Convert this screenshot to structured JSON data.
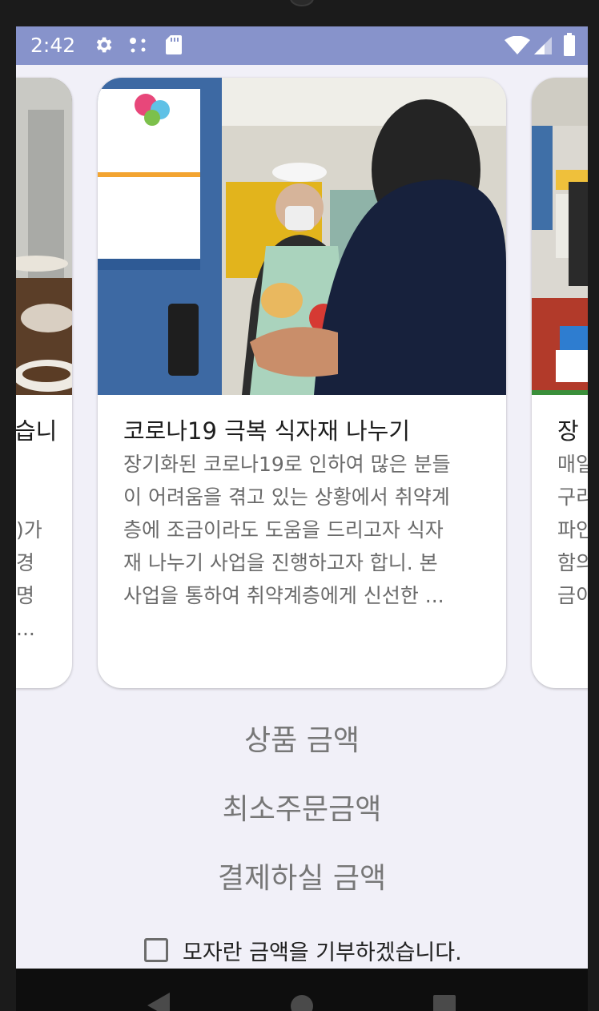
{
  "status_bar": {
    "time": "2:42",
    "icons": [
      "settings-gear-icon",
      "dots-icon",
      "sd-card-icon",
      "wifi-icon",
      "signal-icon",
      "battery-icon"
    ]
  },
  "cards": [
    {
      "title": "습니",
      "desc": "\n\n)가\n경\n명\n..."
    },
    {
      "title": "코로나19 극복 식자재 나누기",
      "desc": "장기화된 코로나19로 인하여 많은 분들\n이 어려움을 겪고 있는 상황에서 취약계\n층에 조금이라도 도움을 드리고자 식자\n재 나누기 사업을 진행하고자 합니. 본\n사업을 통하여 취약계층에게 신선한 ..."
    },
    {
      "title": "장",
      "desc": "매일\n구리\n파인\n함의\n금이"
    }
  ],
  "amounts": {
    "product_amount": "상품 금액",
    "min_order_amount": "최소주문금액",
    "payment_amount": "결제하실 금액"
  },
  "donate": {
    "label": "모자란 금액을 기부하겠습니다.",
    "checked": false
  },
  "nav": {
    "icons": [
      "back-icon",
      "home-icon",
      "recents-icon"
    ]
  }
}
